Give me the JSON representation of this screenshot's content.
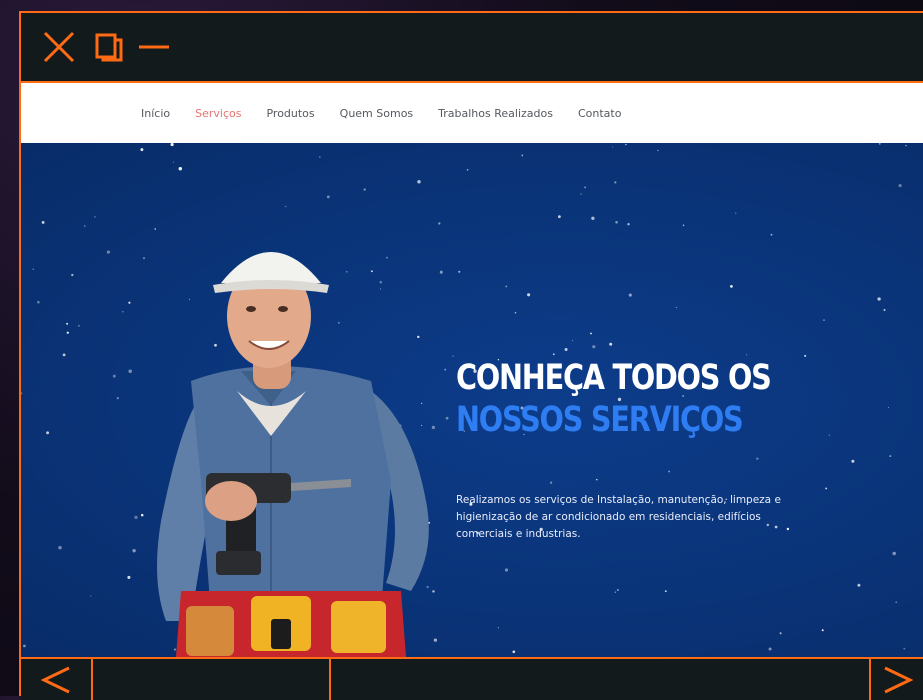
{
  "window": {
    "accent_color": "#ff6a14",
    "controls": {
      "close_icon": "close-icon",
      "maximize_icon": "maximize-icon",
      "minimize_icon": "minimize-icon"
    }
  },
  "nav": {
    "items": [
      {
        "label": "Início",
        "active": false
      },
      {
        "label": "Serviços",
        "active": true
      },
      {
        "label": "Produtos",
        "active": false
      },
      {
        "label": "Quem Somos",
        "active": false
      },
      {
        "label": "Trabalhos Realizados",
        "active": false
      },
      {
        "label": "Contato",
        "active": false
      }
    ],
    "active_color": "#e8736f"
  },
  "hero": {
    "headline_line1": "CONHEÇA TODOS OS",
    "headline_line2": "NOSSOS SERVIÇOS",
    "description": "Realizamos os serviços de Instalação, manutenção, limpeza e higienização de ar condicionado em residenciais, edifícios comerciais e industrias.",
    "background_color": "#0a3479",
    "accent_color": "#2f7df3"
  },
  "bottom_bar": {
    "prev_icon": "chevron-left-icon",
    "next_icon": "chevron-right-icon"
  }
}
